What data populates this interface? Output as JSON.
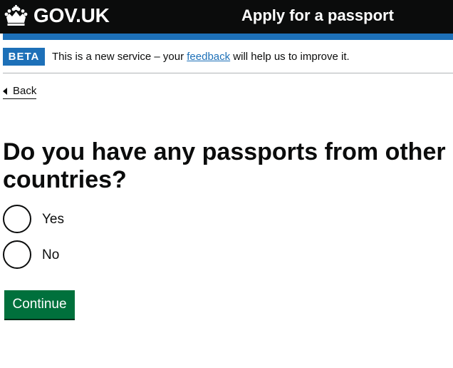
{
  "header": {
    "logo_text": "GOV.UK",
    "service_name": "Apply for a passport"
  },
  "phase_banner": {
    "tag": "BETA",
    "text_before": "This is a new service – your ",
    "link_text": "feedback",
    "text_after": " will help us to improve it."
  },
  "back_link": "Back",
  "question": {
    "heading": "Do you have any passports from other countries?",
    "options": [
      {
        "label": "Yes"
      },
      {
        "label": "No"
      }
    ]
  },
  "continue_label": "Continue",
  "colors": {
    "header_bg": "#0b0c0c",
    "brand_blue": "#1d70b8",
    "button_green": "#00703c",
    "link": "#1d70b8"
  }
}
